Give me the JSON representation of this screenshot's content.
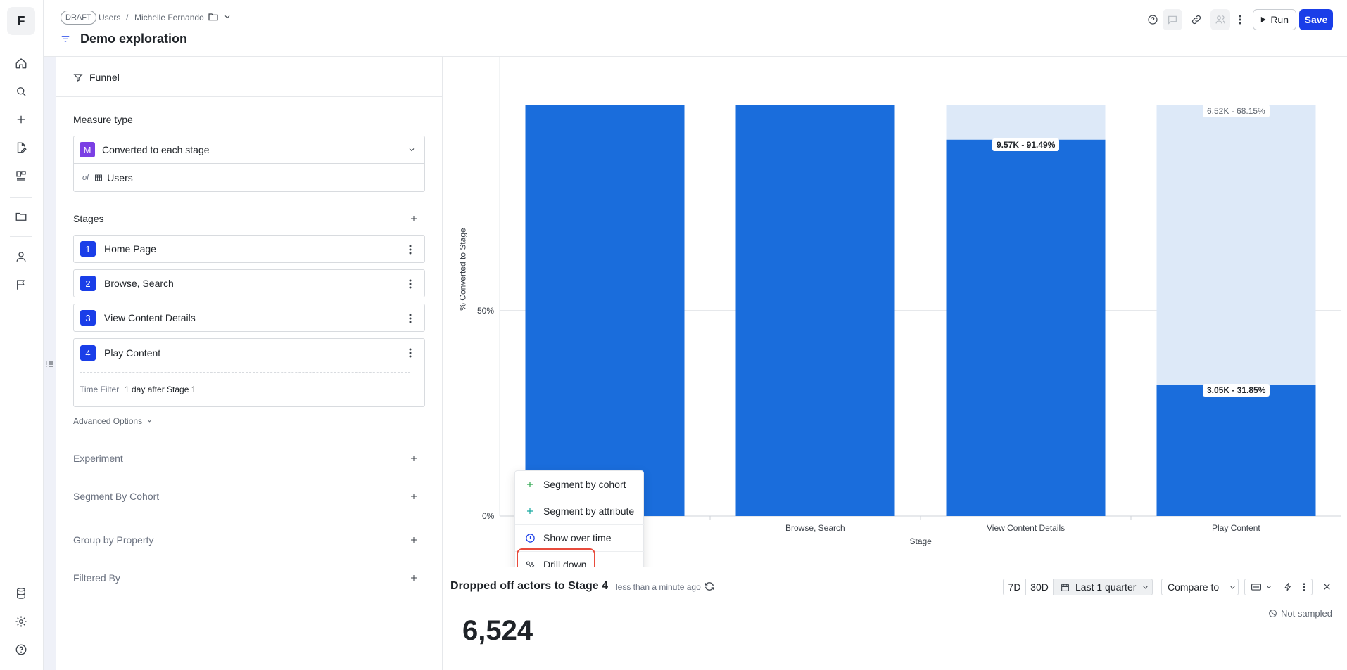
{
  "app": {
    "logo_letter": "F"
  },
  "header": {
    "draft_badge": "DRAFT",
    "breadcrumb": [
      "Users",
      "/",
      "Michelle Fernando"
    ],
    "title": "Demo exploration",
    "run_label": "Run",
    "save_label": "Save"
  },
  "panel": {
    "report_type": "Funnel",
    "measure_type_label": "Measure type",
    "measure": {
      "badge": "M",
      "value": "Converted to each stage",
      "of_label": "of",
      "entity": "Users"
    },
    "stages_label": "Stages",
    "stages": [
      {
        "num": "1",
        "label": "Home Page"
      },
      {
        "num": "2",
        "label": "Browse, Search"
      },
      {
        "num": "3",
        "label": "View Content Details"
      },
      {
        "num": "4",
        "label": "Play Content"
      }
    ],
    "time_filter_label": "Time Filter",
    "time_filter_value": "1 day after Stage 1",
    "advanced_options": "Advanced Options",
    "sections": [
      "Experiment",
      "Segment By Cohort",
      "Group by Property",
      "Filtered By"
    ]
  },
  "chart_data": {
    "type": "bar",
    "xlabel": "Stage",
    "ylabel": "% Converted to Stage",
    "yticks": [
      "50%",
      "0%"
    ],
    "categories": [
      "Home Page",
      "Browse, Search",
      "View Content Details",
      "Play Content"
    ],
    "category_labels_shown": [
      "",
      "Browse, Search",
      "View Content Details",
      "Play Content"
    ],
    "series": [
      {
        "name": "Converted",
        "values": [
          100,
          100,
          91.49,
          31.85
        ],
        "color": "#1a6ddc"
      },
      {
        "name": "Dropped off",
        "values": [
          0,
          0,
          8.51,
          68.15
        ],
        "color": "#dde9f8"
      }
    ],
    "data_labels": [
      {
        "category": "View Content Details",
        "text": "9.57K - 91.49%",
        "kind": "converted"
      },
      {
        "category": "Play Content",
        "text": "3.05K - 31.85%",
        "kind": "converted"
      },
      {
        "category": "Play Content",
        "text": "6.52K - 68.15%",
        "kind": "dropped"
      }
    ],
    "grid": true
  },
  "context_menu": {
    "items": [
      {
        "label": "Segment by cohort",
        "icon": "plus-icon"
      },
      {
        "label": "Segment by attribute",
        "icon": "plus-icon"
      },
      {
        "label": "Show over time",
        "icon": "clock-icon"
      },
      {
        "label": "Drill down",
        "icon": "drill-down-icon"
      }
    ]
  },
  "bottom": {
    "title": "Dropped off actors to Stage 4",
    "updated": "less than a minute ago",
    "range_7d": "7D",
    "range_30d": "30D",
    "date_range": "Last 1 quarter",
    "compare": "Compare to",
    "big_value": "6,524",
    "sampling": "Not sampled"
  },
  "colors": {
    "accent": "#1a3ee8",
    "bar_converted": "#1a6ddc",
    "bar_dropped": "#dde9f8",
    "measure_badge": "#7b3fe4",
    "highlight": "#e84b3c"
  }
}
